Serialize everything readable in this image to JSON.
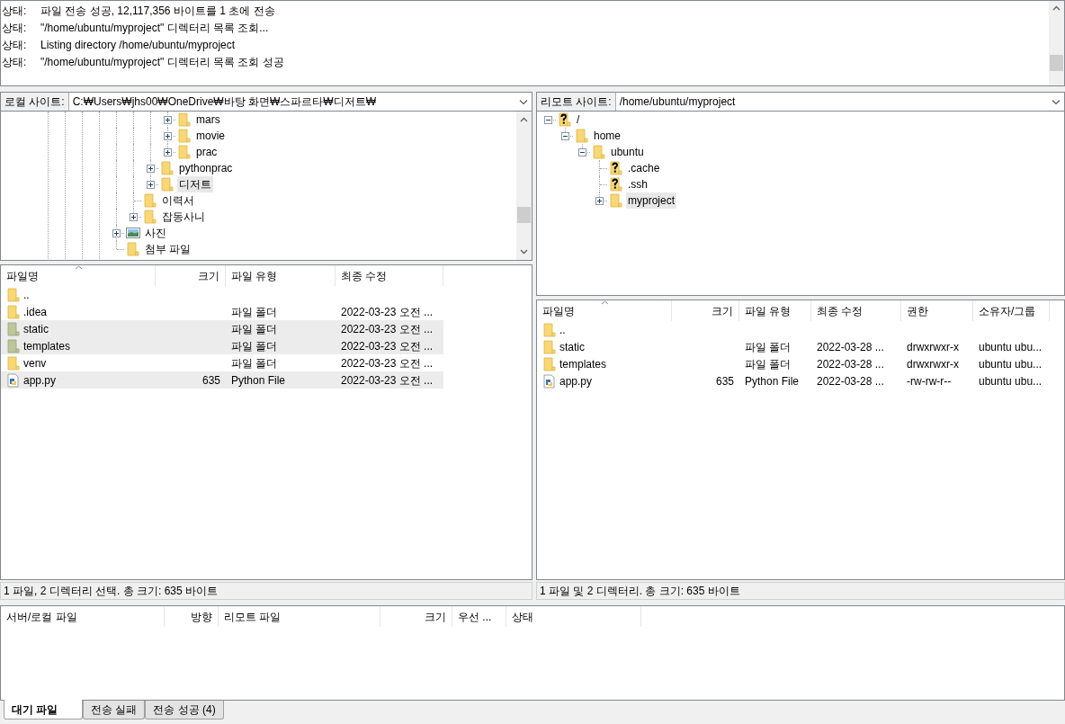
{
  "message_log": {
    "entries": [
      {
        "label": "상태:",
        "text": "파일 전송 성공, 12,117,356 바이트를 1 초에 전송"
      },
      {
        "label": "상태:",
        "text": "\"/home/ubuntu/myproject\" 디렉터리 목록 조회..."
      },
      {
        "label": "상태:",
        "text": "Listing directory /home/ubuntu/myproject"
      },
      {
        "label": "상태:",
        "text": "\"/home/ubuntu/myproject\" 디렉터리 목록 조회 성공"
      }
    ]
  },
  "local": {
    "site_label": "로컬 사이트:",
    "path": "C:₩Users₩jhs00₩OneDrive₩바탕 화면₩스파르타₩디저트₩",
    "tree": [
      {
        "children": [
          {
            "children": [
              {
                "children": [
                  {
                    "label": "mars",
                    "kind": "folder",
                    "expanded": false,
                    "selected": false
                  },
                  {
                    "label": "movie",
                    "kind": "folder",
                    "expanded": false,
                    "selected": false
                  },
                  {
                    "label": "prac",
                    "kind": "folder",
                    "expanded": false,
                    "selected": false
                  }
                ]
              },
              {
                "label": "pythonprac",
                "kind": "folder",
                "expanded": false,
                "selected": false
              },
              {
                "label": "디저트",
                "kind": "folder",
                "expanded": false,
                "selected": true
              }
            ]
          },
          {
            "label": "이력서",
            "kind": "folder",
            "selected": false
          },
          {
            "label": "잡동사니",
            "kind": "folder",
            "expanded": false,
            "selected": false
          }
        ]
      },
      {
        "label": "사진",
        "kind": "image",
        "expanded": false,
        "selected": false
      },
      {
        "label": "첨부 파일",
        "kind": "folder",
        "selected": false
      }
    ],
    "columns": [
      {
        "label": "파일명",
        "sorted": true
      },
      {
        "label": "크기",
        "sorted": false
      },
      {
        "label": "파일 유형",
        "sorted": false
      },
      {
        "label": "최종 수정",
        "sorted": false
      }
    ],
    "rows": [
      {
        "kind": "folder",
        "selected": false,
        "cells": [
          ".."
        ]
      },
      {
        "kind": "folder",
        "selected": false,
        "cells": [
          ".idea",
          null,
          "파일 폴더",
          "2022-03-23 오전 ..."
        ]
      },
      {
        "kind": "folder",
        "selected": true,
        "cells": [
          "static",
          null,
          "파일 폴더",
          "2022-03-23 오전 ..."
        ]
      },
      {
        "kind": "folder",
        "selected": true,
        "cells": [
          "templates",
          null,
          "파일 폴더",
          "2022-03-23 오전 ..."
        ]
      },
      {
        "kind": "folder",
        "selected": false,
        "cells": [
          "venv",
          null,
          "파일 폴더",
          "2022-03-23 오전 ..."
        ]
      },
      {
        "kind": "python",
        "selected": true,
        "cells": [
          "app.py",
          "635",
          "Python File",
          "2022-03-23 오전 ..."
        ]
      }
    ],
    "status": "1 파일, 2 디렉터리 선택. 총 크기: 635 바이트"
  },
  "remote": {
    "site_label": "리모트 사이트:",
    "path": "/home/ubuntu/myproject",
    "tree": [
      {
        "label": "/",
        "kind": "unknown",
        "expanded": true,
        "selected": false,
        "children": [
          {
            "label": "home",
            "kind": "folder",
            "expanded": true,
            "selected": false,
            "children": [
              {
                "label": "ubuntu",
                "kind": "folder",
                "expanded": true,
                "selected": false,
                "children": [
                  {
                    "label": ".cache",
                    "kind": "unknown",
                    "selected": false
                  },
                  {
                    "label": ".ssh",
                    "kind": "unknown",
                    "selected": false
                  },
                  {
                    "label": "myproject",
                    "kind": "folder",
                    "expanded": false,
                    "selected": true
                  }
                ]
              }
            ]
          }
        ]
      }
    ],
    "columns": [
      {
        "label": "파일명",
        "sorted": true
      },
      {
        "label": "크기",
        "sorted": false
      },
      {
        "label": "파일 유형",
        "sorted": false
      },
      {
        "label": "최종 수정",
        "sorted": false
      },
      {
        "label": "권한",
        "sorted": false
      },
      {
        "label": "소유자/그룹",
        "sorted": false
      }
    ],
    "rows": [
      {
        "kind": "folder",
        "selected": false,
        "cells": [
          ".."
        ]
      },
      {
        "kind": "folder",
        "selected": false,
        "cells": [
          "static",
          null,
          "파일 폴더",
          "2022-03-28 ...",
          "drwxrwxr-x",
          "ubuntu ubu..."
        ]
      },
      {
        "kind": "folder",
        "selected": false,
        "cells": [
          "templates",
          null,
          "파일 폴더",
          "2022-03-28 ...",
          "drwxrwxr-x",
          "ubuntu ubu..."
        ]
      },
      {
        "kind": "python",
        "selected": false,
        "cells": [
          "app.py",
          "635",
          "Python File",
          "2022-03-28 ...",
          "-rw-rw-r--",
          "ubuntu ubu..."
        ]
      }
    ],
    "status": "1 파일 및 2 디렉터리. 총 크기: 635 바이트"
  },
  "queue": {
    "columns": [
      {
        "label": "서버/로컬 파일"
      },
      {
        "label": "방향"
      },
      {
        "label": "리모트 파일"
      },
      {
        "label": "크기"
      },
      {
        "label": "우선 ..."
      },
      {
        "label": "상태"
      }
    ],
    "tabs": [
      {
        "label": "대기 파일",
        "selected": true
      },
      {
        "label": "전송 실패",
        "selected": false
      },
      {
        "label": "전송 성공 (4)",
        "selected": false
      }
    ]
  }
}
